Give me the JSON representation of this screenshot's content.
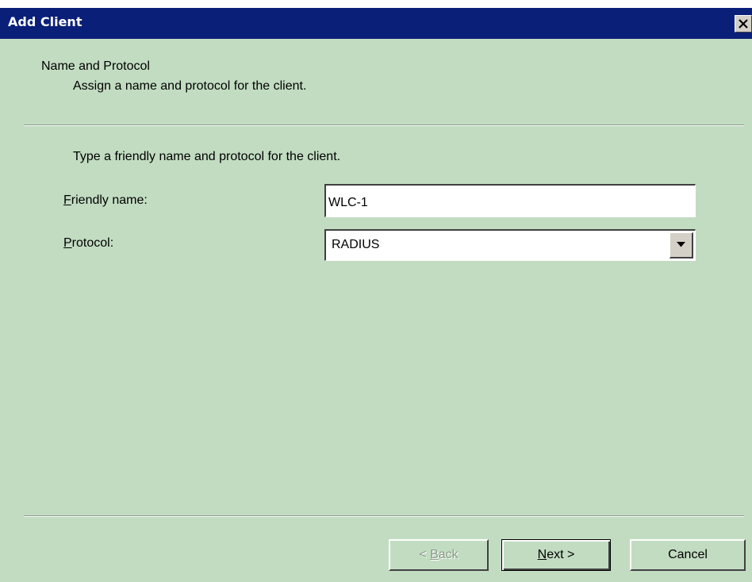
{
  "window": {
    "title": "Add Client",
    "close_glyph": "×"
  },
  "header": {
    "title": "Name and Protocol",
    "subtitle": "Assign a name and protocol for the client."
  },
  "body": {
    "instructions": "Type a friendly name and protocol for the client."
  },
  "fields": {
    "friendly_name": {
      "label_mnemonic": "F",
      "label_rest": "riendly name:",
      "value": "WLC-1"
    },
    "protocol": {
      "label_mnemonic": "P",
      "label_rest": "rotocol:",
      "value": "RADIUS"
    }
  },
  "buttons": {
    "back": {
      "prefix": "< ",
      "mnemonic": "B",
      "rest": "ack"
    },
    "next": {
      "mnemonic": "N",
      "rest": "ext >"
    },
    "cancel": {
      "label": "Cancel"
    }
  },
  "icons": {
    "close": "close-icon",
    "dropdown": "chevron-down-icon"
  },
  "colors": {
    "titlebar": "#0a1f78",
    "dialog_background": "#c2dcc2"
  }
}
